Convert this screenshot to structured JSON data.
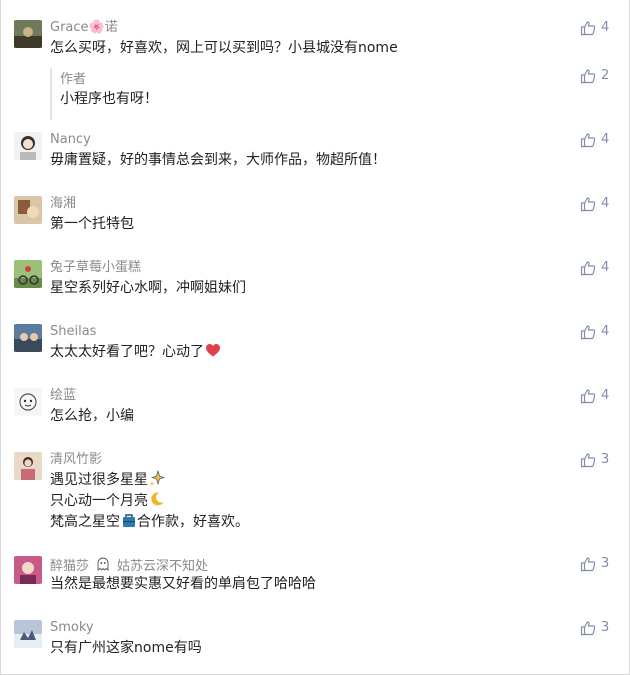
{
  "comments": [
    {
      "name": "Grace🌸诺",
      "text": "怎么买呀，好喜欢，网上可以买到吗？小县城没有nome",
      "likes": "4",
      "reply": {
        "name": "作者",
        "text": "小程序也有呀！",
        "likes": "2"
      }
    },
    {
      "name": "Nancy",
      "text": "毋庸置疑，好的事情总会到来，大师作品，物超所值！",
      "likes": "4"
    },
    {
      "name": "海湘",
      "text": "第一个托特包",
      "likes": "4"
    },
    {
      "name": "兔子草莓小蛋糕",
      "text": "星空系列好心水啊，冲啊姐妹们",
      "likes": "4"
    },
    {
      "name": "Sheilas",
      "text": "太太太好看了吧？心动了",
      "likes": "4"
    },
    {
      "name": "绘蓝",
      "text": "怎么抢，小编",
      "likes": "4"
    },
    {
      "name": "清风竹影",
      "lines": [
        "遇见过很多星星",
        "只心动一个月亮",
        "梵高之星空",
        "合作款，好喜欢。"
      ],
      "likes": "3"
    },
    {
      "name": "醉猫莎",
      "name_suffix": "姑苏云深不知处",
      "text": "当然是最想要实惠又好看的单肩包了哈哈哈",
      "likes": "3"
    },
    {
      "name": "Smoky",
      "text": "只有广州这家nome有吗",
      "likes": "3"
    }
  ],
  "colors": {
    "name": "#8a8a8a",
    "text": "#222222",
    "like": "#7e8ea8",
    "heart": "#e0414b"
  }
}
